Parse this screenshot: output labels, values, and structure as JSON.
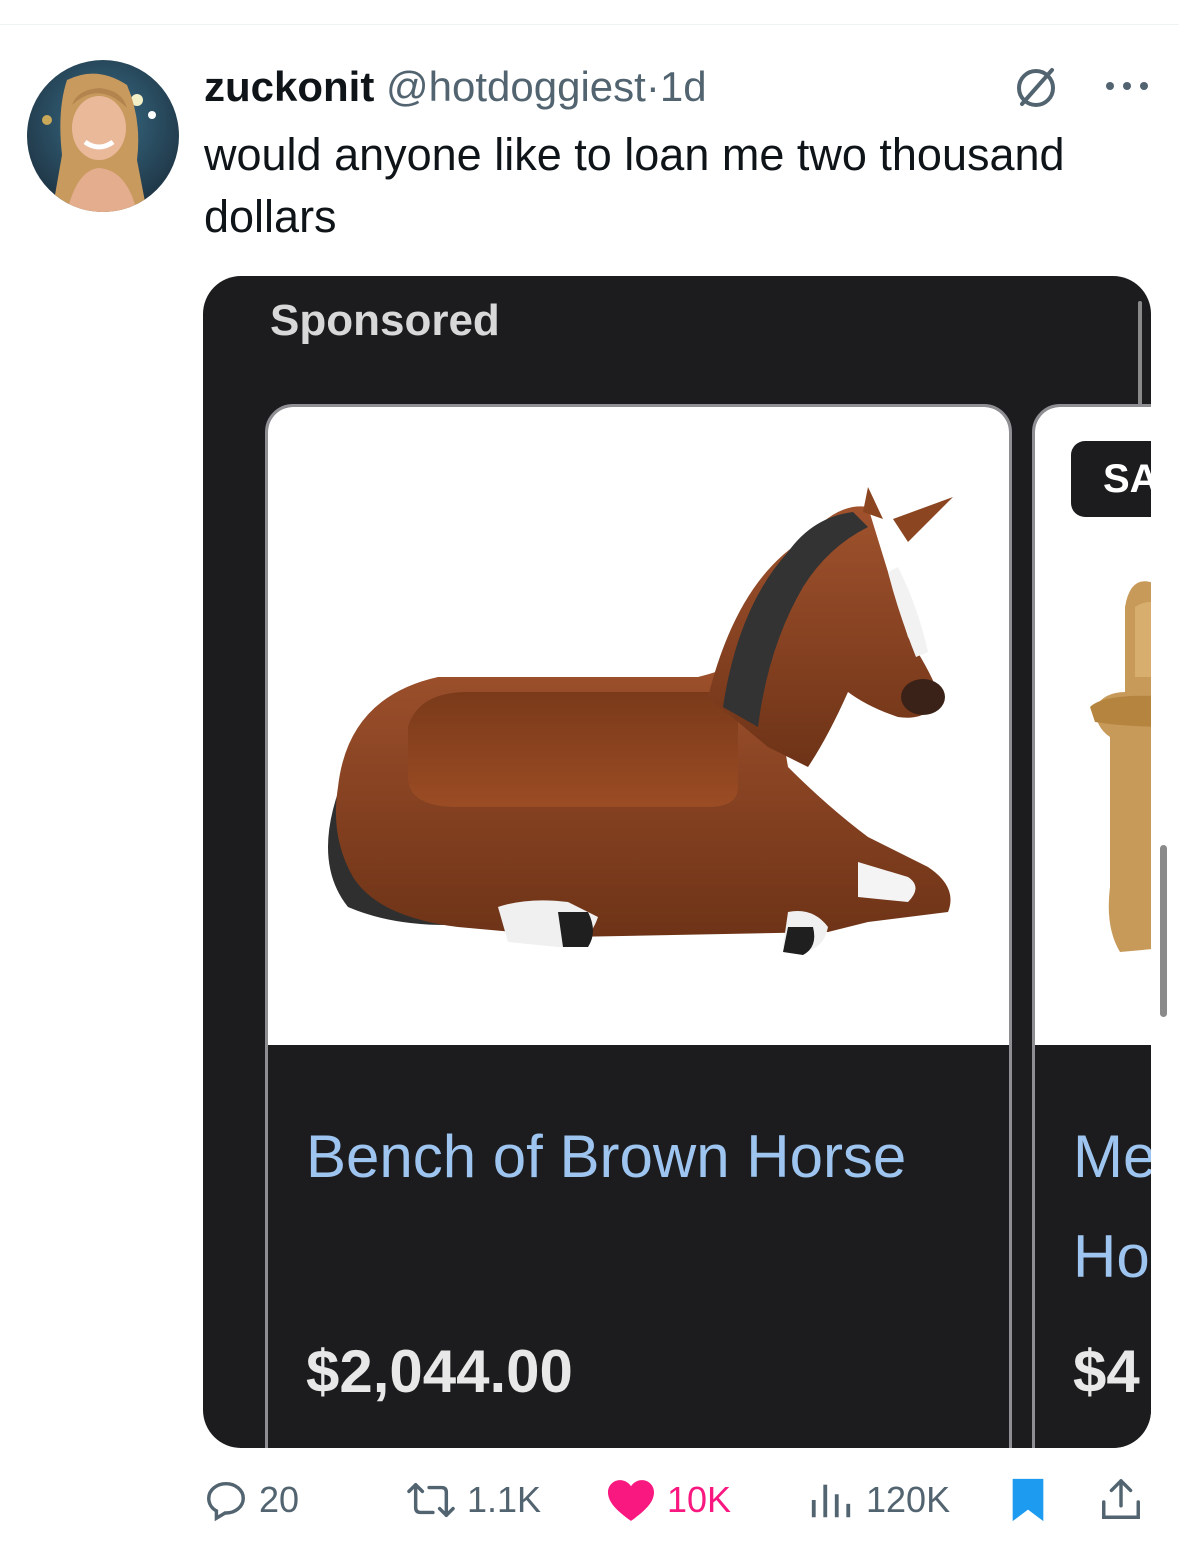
{
  "tweet": {
    "display_name": "zuckonit",
    "handle": "@hotdoggiest",
    "separator": "·",
    "time": "1d",
    "text": "would anyone like to loan me two thousand dollars",
    "avatar_icon": "profile-photo",
    "grok_icon": "grok-icon",
    "more_icon": "more-icon"
  },
  "card": {
    "sponsored_label": "Sponsored",
    "products": [
      {
        "title": "Bench of Brown Horse",
        "price": "$2,044.00",
        "image": "horse-bench-photo"
      },
      {
        "badge": "SA",
        "title_line1": "Me",
        "title_line2": "Ho",
        "price": "$4",
        "image": "wooden-chair-photo"
      }
    ]
  },
  "actions": {
    "replies": "20",
    "reposts": "1.1K",
    "likes": "10K",
    "views": "120K",
    "like_color": "#f91880",
    "bookmark_color": "#1d9bf0"
  }
}
